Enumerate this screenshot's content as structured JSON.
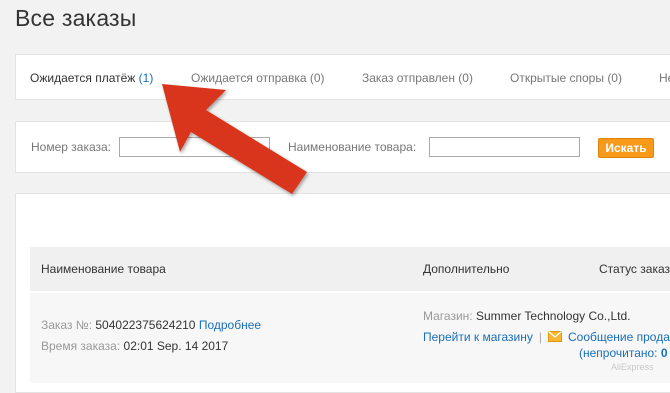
{
  "page": {
    "title": "Все заказы"
  },
  "tabs": [
    {
      "label": "Ожидается платёж",
      "count": "(1)",
      "active": true
    },
    {
      "label": "Ожидается отправка (0)"
    },
    {
      "label": "Заказ отправлен (0)"
    },
    {
      "label": "Открытые споры (0)"
    },
    {
      "label": "Не"
    }
  ],
  "search": {
    "order_label": "Номер заказа:",
    "order_value": "",
    "product_label": "Наименование товара:",
    "product_value": "",
    "button_label": "Искать"
  },
  "table": {
    "headers": [
      "Наименование товара",
      "Дополнительно",
      "Статус заказа"
    ]
  },
  "order": {
    "number_label": "Заказ №:",
    "number": "504022375624210",
    "details_link": "Подробнее",
    "time_label": "Время заказа:",
    "time": "02:01 Sep. 14 2017",
    "shop_label": "Магазин:",
    "shop_name": "Summer Technology Co.,Ltd.",
    "goto_shop": "Перейти к магазину",
    "separator": "|",
    "message_link": "Сообщение продавцу",
    "unread_label": "(непрочитано:",
    "unread_count": "0"
  },
  "watermark": "AliExpress",
  "colors": {
    "accent": "#f79a1b",
    "link": "#1a6fb8",
    "annotation_arrow": "#d9361a"
  }
}
